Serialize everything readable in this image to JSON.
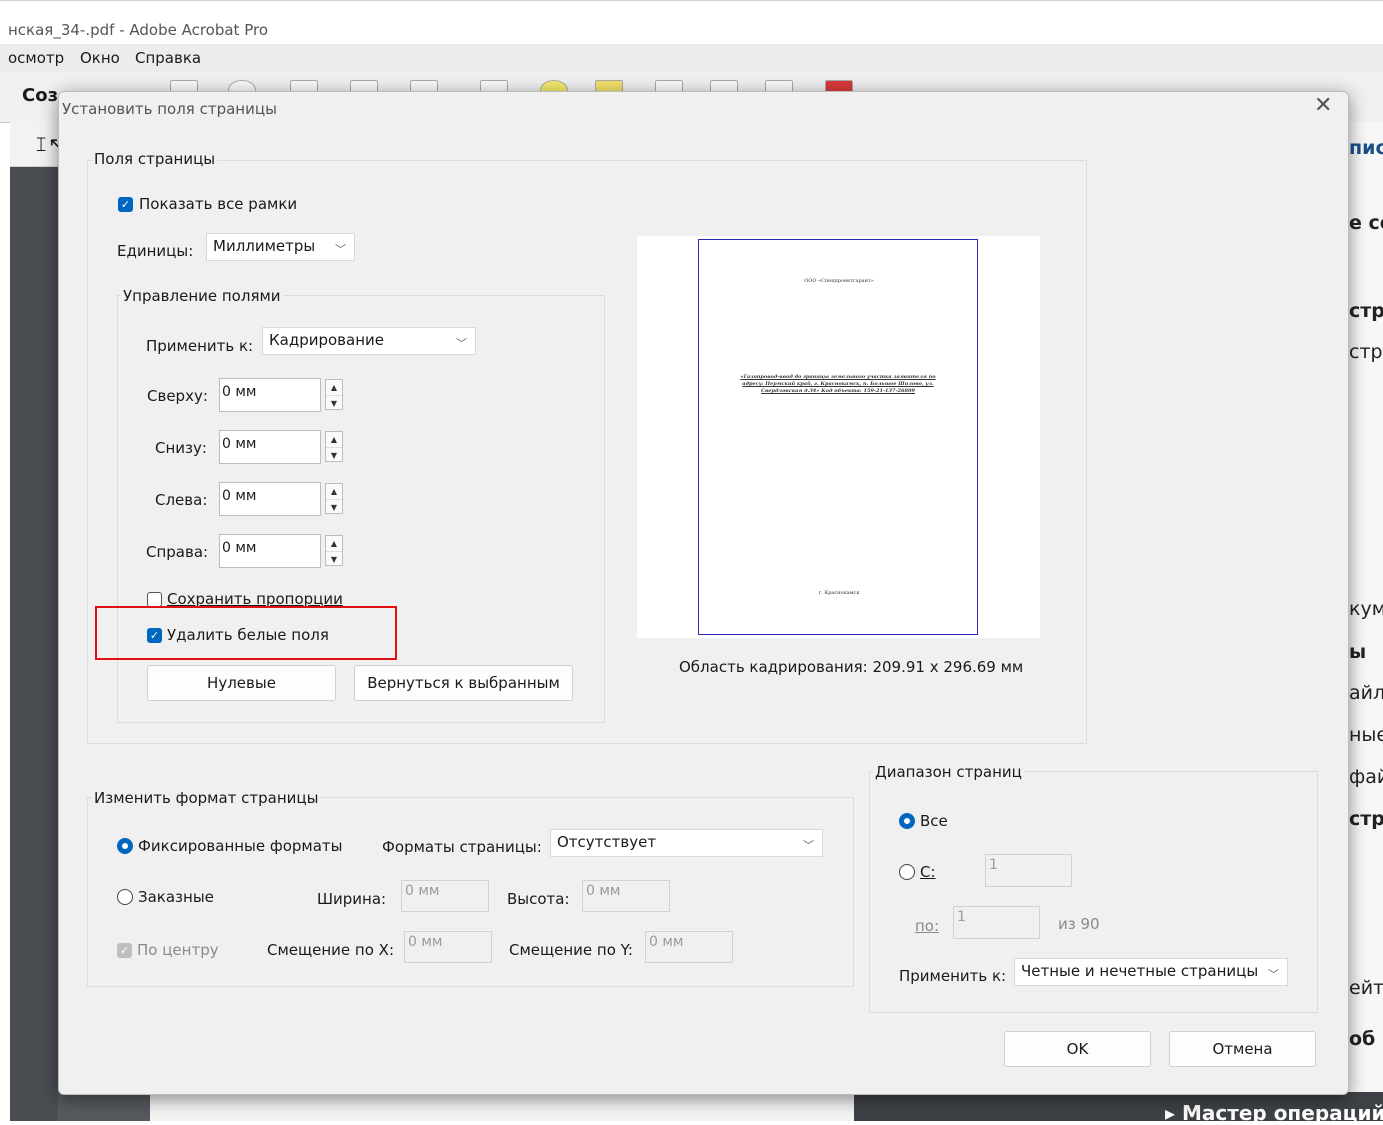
{
  "app": {
    "window_title": "нская_34-.pdf - Adobe Acrobat Pro",
    "menu": [
      "осмотр",
      "Окно",
      "Справка"
    ],
    "toolbar_label": "Соз",
    "right_panel_fragments": [
      "пис",
      "е со",
      "стра",
      "стра",
      "куме",
      "ы",
      "айла",
      "ные",
      "файл",
      "стра",
      "ейтс",
      "об"
    ],
    "bottom_fragment": "▸ Мастер операций"
  },
  "dialog": {
    "title": "Установить поля страницы",
    "close": "✕",
    "margins_group": {
      "label": "Поля страницы",
      "show_all_boxes": {
        "label": "Показать все рамки",
        "checked": true
      },
      "units": {
        "label": "Единицы:",
        "value": "Миллиметры"
      },
      "margin_controls": {
        "label": "Управление полями",
        "apply_to": {
          "label": "Применить к:",
          "value": "Кадрирование"
        },
        "top": {
          "label": "Сверху:",
          "value": "0 мм"
        },
        "bottom": {
          "label": "Снизу:",
          "value": "0 мм"
        },
        "left": {
          "label": "Слева:",
          "value": "0 мм"
        },
        "right": {
          "label": "Справа:",
          "value": "0 мм"
        },
        "keep_proportions": {
          "label": "Сохранить пропорции",
          "checked": false
        },
        "remove_white_margins": {
          "label": "Удалить белые поля",
          "checked": true
        },
        "zero_button": "Нулевые",
        "revert_button": "Вернуться к выбранным"
      },
      "preview": {
        "crop_area_label": "Область кадрирования: 209.91 x 296.69 мм",
        "page_header": "ООО «Спецпроектгарант»",
        "page_title": "«Газопровод-ввод до границы земельного участка заявителя по адресу: Пермский край, г. Краснокамск, п. Большое Шилово, ул. Свердловская д.34» Код объекта: 159-21-137-26809",
        "page_footer": "г. Краснокамск"
      }
    },
    "format_group": {
      "label": "Изменить формат страницы",
      "fixed": {
        "label": "Фиксированные форматы",
        "selected": true
      },
      "page_formats": {
        "label": "Форматы страницы:",
        "value": "Отсутствует"
      },
      "custom": {
        "label": "Заказные",
        "selected": false
      },
      "width": {
        "label": "Ширина:",
        "value": "0 мм"
      },
      "height": {
        "label": "Высота:",
        "value": "0 мм"
      },
      "center": {
        "label": "По центру",
        "checked": true
      },
      "offset_x": {
        "label": "Смещение по X:",
        "value": "0 мм"
      },
      "offset_y": {
        "label": "Смещение по Y:",
        "value": "0 мм"
      }
    },
    "range_group": {
      "label": "Диапазон страниц",
      "all": {
        "label": "Все",
        "selected": true
      },
      "from": {
        "label": "С:",
        "value": "1",
        "selected": false
      },
      "to": {
        "label": "по:",
        "value": "1"
      },
      "of": "из 90",
      "apply_to": {
        "label": "Применить к:",
        "value": "Четные и нечетные страницы"
      }
    },
    "ok_button": "OK",
    "cancel_button": "Отмена"
  },
  "colors": {
    "accent": "#0067c0",
    "highlight": "#e01010"
  }
}
